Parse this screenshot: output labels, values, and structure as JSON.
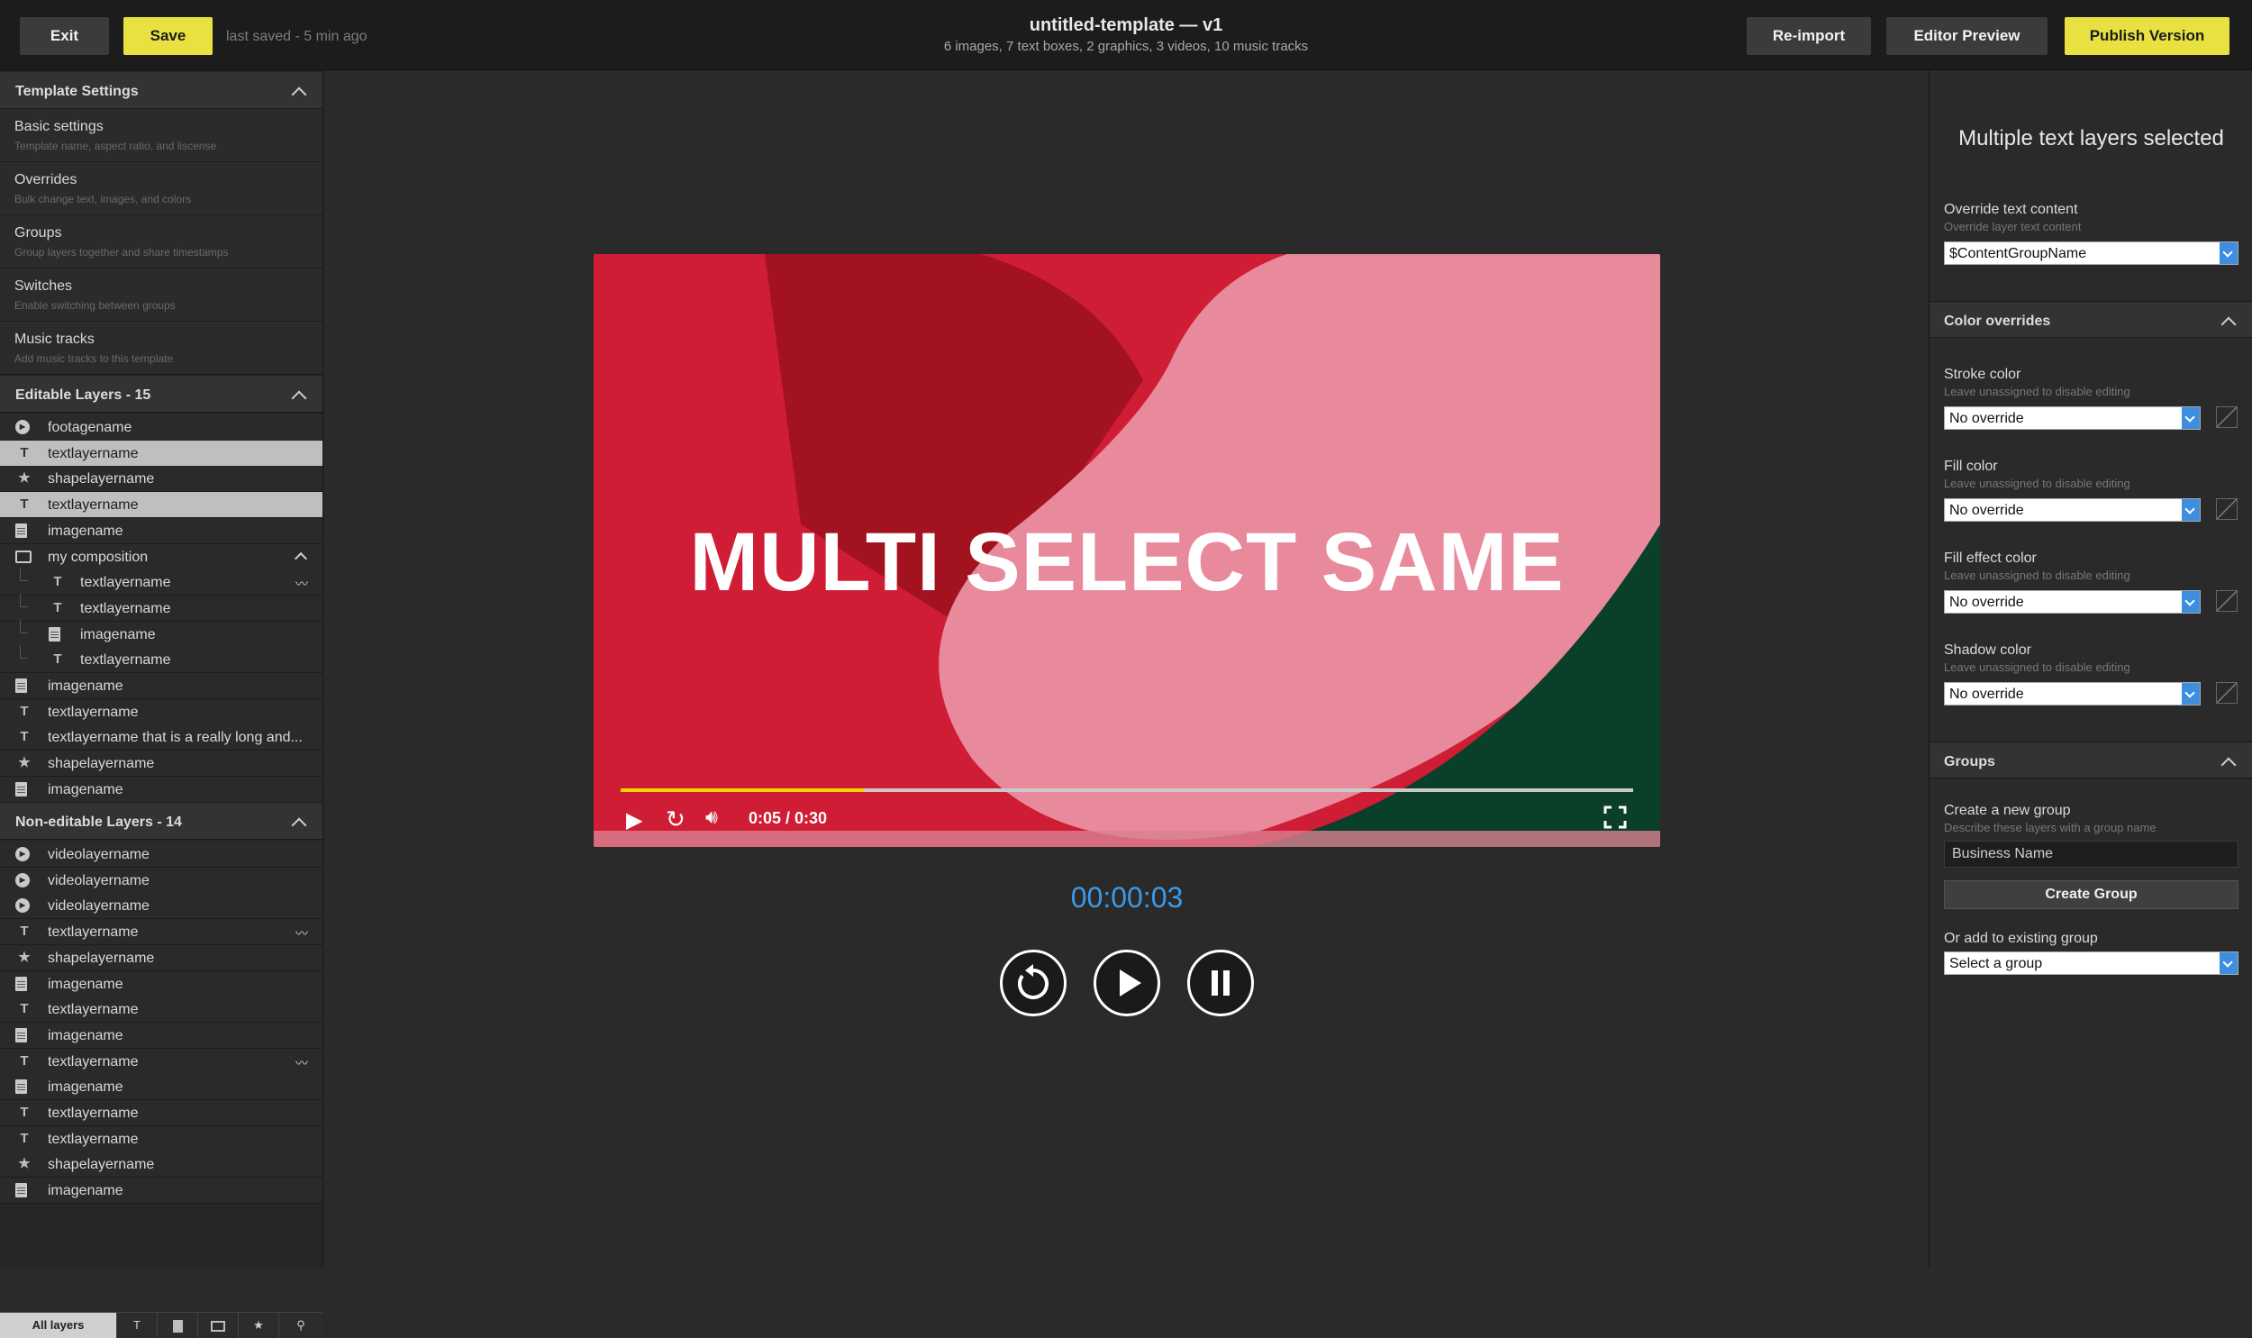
{
  "topbar": {
    "exit_label": "Exit",
    "save_label": "Save",
    "last_saved": "last saved - 5 min ago",
    "title": "untitled-template — v1",
    "summary": "6 images, 7 text boxes, 2 graphics, 3 videos, 10 music tracks",
    "reimport_label": "Re-import",
    "editor_preview_label": "Editor Preview",
    "publish_label": "Publish Version"
  },
  "template_settings": {
    "header": "Template Settings",
    "items": [
      {
        "title": "Basic settings",
        "sub": "Template name, aspect ratio, and liscense"
      },
      {
        "title": "Overrides",
        "sub": "Bulk change text, images, and colors"
      },
      {
        "title": "Groups",
        "sub": "Group layers together and share timestamps"
      },
      {
        "title": "Switches",
        "sub": "Enable switching between groups"
      },
      {
        "title": "Music tracks",
        "sub": "Add music tracks to this template"
      }
    ]
  },
  "editable_layers": {
    "header": "Editable Layers - 15",
    "rows": [
      {
        "icon": "video-icon",
        "label": "footagename"
      },
      {
        "icon": "text-icon",
        "label": "textlayername"
      },
      {
        "icon": "shape-icon",
        "label": "shapelayername"
      },
      {
        "icon": "text-icon",
        "label": "textlayername"
      },
      {
        "icon": "image-icon",
        "label": "imagename"
      },
      {
        "icon": "composition-icon",
        "label": "my composition"
      },
      {
        "icon": "text-icon",
        "label": "textlayername"
      },
      {
        "icon": "text-icon",
        "label": "textlayername"
      },
      {
        "icon": "image-icon",
        "label": "imagename"
      },
      {
        "icon": "text-icon",
        "label": "textlayername"
      },
      {
        "icon": "image-icon",
        "label": "imagename"
      },
      {
        "icon": "text-icon",
        "label": "textlayername"
      },
      {
        "icon": "text-icon",
        "label": "textlayername that is a really long and..."
      },
      {
        "icon": "shape-icon",
        "label": "shapelayername"
      },
      {
        "icon": "image-icon",
        "label": "imagename"
      }
    ]
  },
  "non_editable_layers": {
    "header": "Non-editable Layers - 14",
    "rows": [
      {
        "icon": "video-icon",
        "label": "videolayername"
      },
      {
        "icon": "video-icon",
        "label": "videolayername"
      },
      {
        "icon": "video-icon",
        "label": "videolayername"
      },
      {
        "icon": "text-icon",
        "label": "textlayername"
      },
      {
        "icon": "shape-icon",
        "label": "shapelayername"
      },
      {
        "icon": "image-icon",
        "label": "imagename"
      },
      {
        "icon": "text-icon",
        "label": "textlayername"
      },
      {
        "icon": "image-icon",
        "label": "imagename"
      },
      {
        "icon": "text-icon",
        "label": "textlayername"
      },
      {
        "icon": "image-icon",
        "label": "imagename"
      },
      {
        "icon": "text-icon",
        "label": "textlayername"
      },
      {
        "icon": "text-icon",
        "label": "textlayername"
      },
      {
        "icon": "shape-icon",
        "label": "shapelayername"
      },
      {
        "icon": "image-icon",
        "label": "imagename"
      }
    ]
  },
  "bottom_tabs": {
    "all_layers_label": "All layers",
    "icons": [
      "text-icon",
      "image-icon",
      "composition-icon",
      "shape-icon",
      "link-icon"
    ]
  },
  "preview": {
    "overlay_text": "MULTI SELECT SAME",
    "time_display": "0:05 / 0:30",
    "progress": 0.24,
    "timecode": "00:00:03"
  },
  "right_panel": {
    "title": "Multiple text layers selected",
    "override_label": "Override text content",
    "override_sub": "Override layer text content",
    "override_value": "$ContentGroupName",
    "color_overrides_header": "Color overrides",
    "colors": [
      {
        "label": "Stroke color",
        "sub": "Leave unassigned to disable editing",
        "value": "No override"
      },
      {
        "label": "Fill color",
        "sub": "Leave unassigned to disable editing",
        "value": "No override"
      },
      {
        "label": "Fill effect color",
        "sub": "Leave unassigned to disable editing",
        "value": "No override"
      },
      {
        "label": "Shadow color",
        "sub": "Leave unassigned to disable editing",
        "value": "No override"
      }
    ],
    "groups_header": "Groups",
    "new_group_label": "Create a new group",
    "new_group_sub": "Describe these layers with a group name",
    "group_name_value": "Business Name",
    "create_group_label": "Create Group",
    "existing_group_label": "Or add to existing group",
    "existing_group_value": "Select a group"
  },
  "colors": {
    "accent_yellow": "#e8e141",
    "timecode_blue": "#3b9ae8",
    "select_blue": "#3e8ee0"
  }
}
